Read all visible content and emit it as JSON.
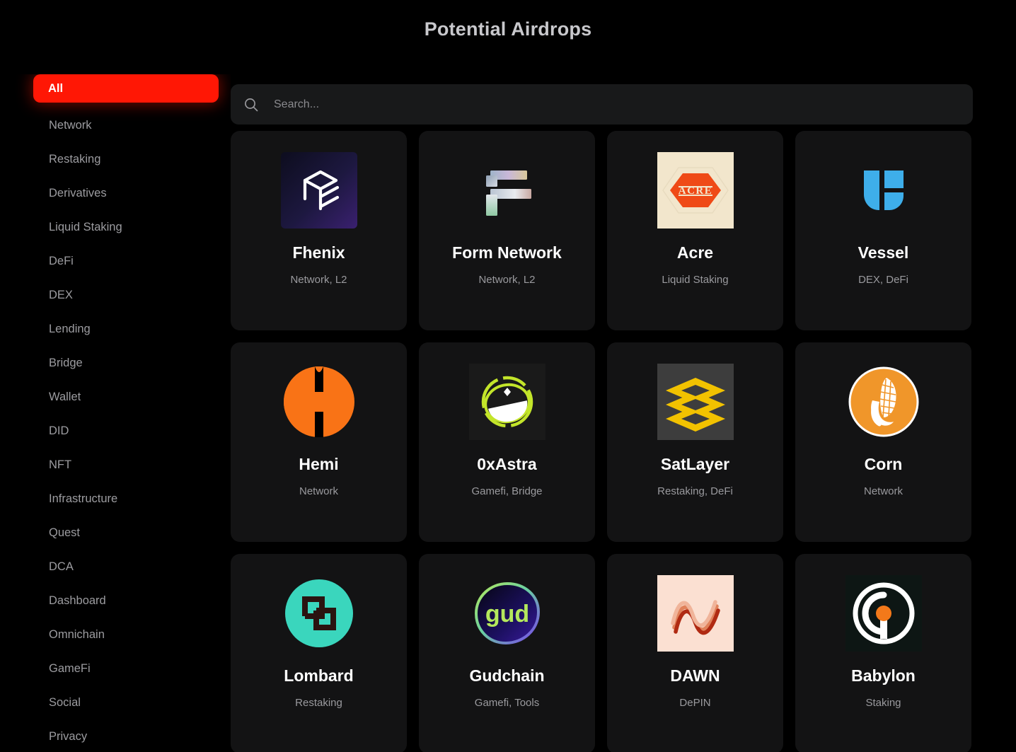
{
  "header": {
    "title": "Potential Airdrops"
  },
  "search": {
    "icon": "search-icon",
    "placeholder": "Search...",
    "value": ""
  },
  "sidebar": {
    "items": [
      {
        "label": "All",
        "active": true
      },
      {
        "label": "Network",
        "active": false
      },
      {
        "label": "Restaking",
        "active": false
      },
      {
        "label": "Derivatives",
        "active": false
      },
      {
        "label": "Liquid Staking",
        "active": false
      },
      {
        "label": "DeFi",
        "active": false
      },
      {
        "label": "DEX",
        "active": false
      },
      {
        "label": "Lending",
        "active": false
      },
      {
        "label": "Bridge",
        "active": false
      },
      {
        "label": "Wallet",
        "active": false
      },
      {
        "label": "DID",
        "active": false
      },
      {
        "label": "NFT",
        "active": false
      },
      {
        "label": "Infrastructure",
        "active": false
      },
      {
        "label": "Quest",
        "active": false
      },
      {
        "label": "DCA",
        "active": false
      },
      {
        "label": "Dashboard",
        "active": false
      },
      {
        "label": "Omnichain",
        "active": false
      },
      {
        "label": "GameFi",
        "active": false
      },
      {
        "label": "Social",
        "active": false
      },
      {
        "label": "Privacy",
        "active": false
      }
    ]
  },
  "cards": [
    {
      "name": "Fhenix",
      "tags": "Network, L2",
      "logo": "fhenix-logo"
    },
    {
      "name": "Form Network",
      "tags": "Network, L2",
      "logo": "form-network-logo"
    },
    {
      "name": "Acre",
      "tags": "Liquid Staking",
      "logo": "acre-logo"
    },
    {
      "name": "Vessel",
      "tags": "DEX, DeFi",
      "logo": "vessel-logo"
    },
    {
      "name": "Hemi",
      "tags": "Network",
      "logo": "hemi-logo"
    },
    {
      "name": "0xAstra",
      "tags": "Gamefi, Bridge",
      "logo": "0xastra-logo"
    },
    {
      "name": "SatLayer",
      "tags": "Restaking, DeFi",
      "logo": "satlayer-logo"
    },
    {
      "name": "Corn",
      "tags": "Network",
      "logo": "corn-logo"
    },
    {
      "name": "Lombard",
      "tags": "Restaking",
      "logo": "lombard-logo"
    },
    {
      "name": "Gudchain",
      "tags": "Gamefi, Tools",
      "logo": "gudchain-logo"
    },
    {
      "name": "DAWN",
      "tags": "DePIN",
      "logo": "dawn-logo"
    },
    {
      "name": "Babylon",
      "tags": "Staking",
      "logo": "babylon-logo"
    }
  ],
  "colors": {
    "background": "#000000",
    "card_background": "#131314",
    "accent_red": "#ff1705",
    "search_background": "#18191a",
    "title_text": "#c8c8cc",
    "muted_text": "#9a9a9e"
  }
}
